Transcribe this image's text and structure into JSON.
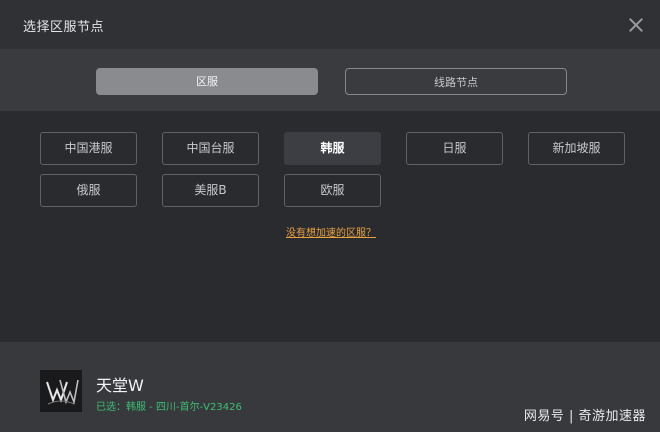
{
  "window": {
    "title": "选择区服节点"
  },
  "tabs": [
    {
      "label": "区服",
      "active": true
    },
    {
      "label": "线路节点",
      "active": false
    }
  ],
  "regions": [
    {
      "label": "中国港服",
      "selected": false
    },
    {
      "label": "中国台服",
      "selected": false
    },
    {
      "label": "韩服",
      "selected": true
    },
    {
      "label": "日服",
      "selected": false
    },
    {
      "label": "新加坡服",
      "selected": false
    },
    {
      "label": "俄服",
      "selected": false
    },
    {
      "label": "美服B",
      "selected": false
    },
    {
      "label": "欧服",
      "selected": false
    }
  ],
  "help_link": "没有想加速的区服？",
  "footer": {
    "game_name": "天堂W",
    "selected_text": "已选：韩服 - 四川-首尔-V23426",
    "watermark": "网易号 | 奇游加速器"
  },
  "colors": {
    "accent_link": "#e8a040",
    "selected_green": "#3cbf74"
  }
}
